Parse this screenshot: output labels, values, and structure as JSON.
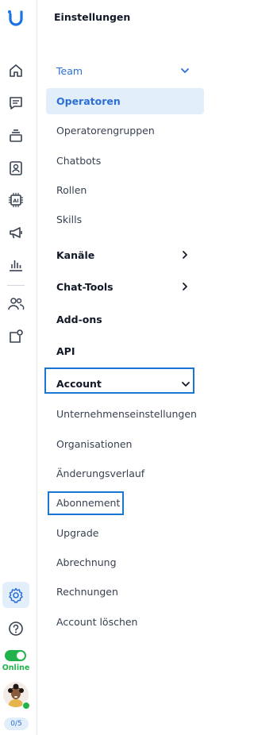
{
  "sidebar": {
    "status_label": "Online",
    "count_badge": "0/5",
    "icons": [
      "logo-icon",
      "home-icon",
      "chat-icon",
      "inbox-icon",
      "contacts-icon",
      "ai-chip-icon",
      "megaphone-icon",
      "bar-chart-icon",
      "people-icon",
      "integrations-icon",
      "settings-icon",
      "help-icon"
    ]
  },
  "settings": {
    "title": "Einstellungen",
    "items": [
      {
        "label": "Team"
      },
      {
        "label": "Operatoren"
      },
      {
        "label": "Operatorengruppen"
      },
      {
        "label": "Chatbots"
      },
      {
        "label": "Rollen"
      },
      {
        "label": "Skills"
      },
      {
        "label": "Kanäle"
      },
      {
        "label": "Chat-Tools"
      },
      {
        "label": "Add-ons"
      },
      {
        "label": "API"
      },
      {
        "label": "Account"
      },
      {
        "label": "Unternehmenseinstellungen"
      },
      {
        "label": "Organisationen"
      },
      {
        "label": "Änderungsverlauf"
      },
      {
        "label": "Abonnement"
      },
      {
        "label": "Upgrade"
      },
      {
        "label": "Abrechnung"
      },
      {
        "label": "Rechnungen"
      },
      {
        "label": "Account löschen"
      }
    ]
  },
  "colors": {
    "accent": "#2b6fd6",
    "highlight": "#1976d2",
    "online": "#22b24c",
    "selected_bg": "#e3eefb"
  }
}
